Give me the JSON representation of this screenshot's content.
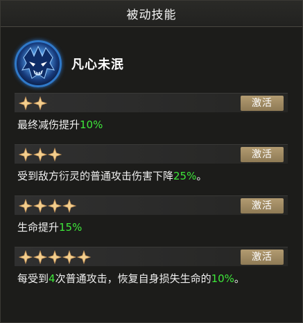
{
  "panel": {
    "title": "被动技能"
  },
  "skill": {
    "name": "凡心未泯",
    "icon": "blue-demon-mask-icon"
  },
  "colors": {
    "highlight": "#3ee83a",
    "button": "#a38d63",
    "star": "#f3cf8e"
  },
  "tiers": [
    {
      "stars": 2,
      "button": "激活",
      "desc_pre": "最终减伤提升",
      "desc_value": "10%",
      "desc_post": ""
    },
    {
      "stars": 3,
      "button": "激活",
      "desc_pre": "受到敌方衍灵的普通攻击伤害下降",
      "desc_value": "25%",
      "desc_post": "。"
    },
    {
      "stars": 4,
      "button": "激活",
      "desc_pre": "生命提升",
      "desc_value": "15%",
      "desc_post": ""
    },
    {
      "stars": 5,
      "button": "激活",
      "desc_pre": "每受到",
      "desc_value": "4",
      "desc_mid": "次普通攻击，恢复自身损失生命的",
      "desc_value2": "10%",
      "desc_post": "。"
    }
  ]
}
